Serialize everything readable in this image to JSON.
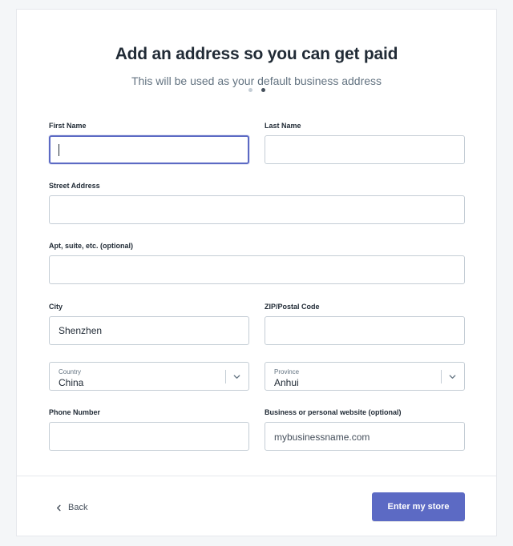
{
  "header": {
    "title": "Add an address so you can get paid",
    "subtitle": "This will be used as your default business address",
    "step_dots": {
      "count": 2,
      "active_index": 1
    }
  },
  "form": {
    "first_name": {
      "label": "First Name",
      "value": ""
    },
    "last_name": {
      "label": "Last Name",
      "value": ""
    },
    "street_address": {
      "label": "Street Address",
      "value": ""
    },
    "apt": {
      "label": "Apt, suite, etc. (optional)",
      "value": ""
    },
    "city": {
      "label": "City",
      "value": "Shenzhen"
    },
    "zip": {
      "label": "ZIP/Postal Code",
      "value": ""
    },
    "country": {
      "label": "Country",
      "value": "China"
    },
    "province": {
      "label": "Province",
      "value": "Anhui"
    },
    "phone": {
      "label": "Phone Number",
      "value": ""
    },
    "website": {
      "label": "Business or personal website (optional)",
      "placeholder": "mybusinessname.com"
    }
  },
  "footer": {
    "back_label": "Back",
    "submit_label": "Enter my store"
  },
  "colors": {
    "accent": "#5c6ac4",
    "text": "#212b36",
    "muted": "#637381",
    "border": "#c4cdd5"
  }
}
